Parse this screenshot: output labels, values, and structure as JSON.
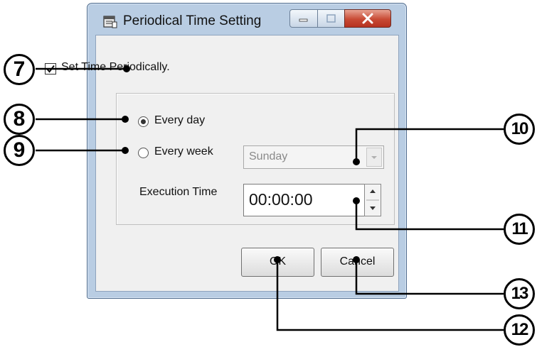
{
  "window": {
    "title": "Periodical Time Setting",
    "title_icon": "calendar-icon",
    "controls": [
      "minimize-icon",
      "maximize-icon",
      "close-icon"
    ]
  },
  "options": {
    "set_time_periodically": {
      "label": "Set Time Periodically.",
      "checked": true
    },
    "every_day": {
      "label": "Every day",
      "selected": true
    },
    "every_week": {
      "label": "Every week",
      "selected": false
    },
    "weekday": {
      "value": "Sunday",
      "enabled": false
    },
    "execution_time": {
      "label": "Execution Time",
      "value": "00:00:00"
    }
  },
  "buttons": {
    "ok": "OK",
    "cancel": "Cancel"
  },
  "callouts": {
    "c7": "7",
    "c8": "8",
    "c9": "9",
    "c10": "10",
    "c11": "11",
    "c12": "12",
    "c13": "13"
  },
  "colors": {
    "close_button": "#c84a34",
    "title_bar": "#b9cde3"
  }
}
